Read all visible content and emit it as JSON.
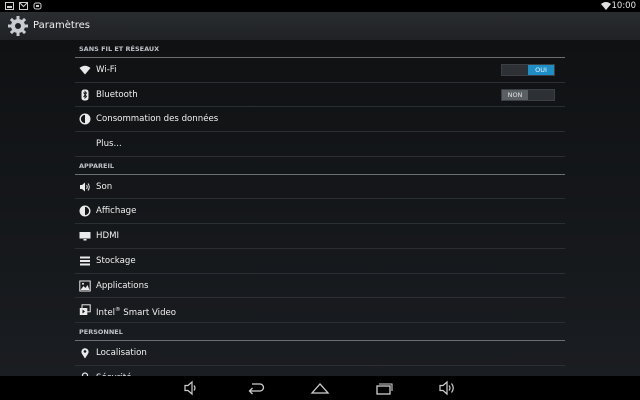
{
  "status_bar": {
    "time": "10:00"
  },
  "action_bar": {
    "title": "Paramètres"
  },
  "sections": [
    {
      "title": "SANS FIL ET RÉSEAUX"
    },
    {
      "title": "APPAREIL"
    },
    {
      "title": "PERSONNEL"
    }
  ],
  "items": {
    "wifi": {
      "label": "Wi-Fi",
      "toggle": "OUI"
    },
    "bluetooth": {
      "label": "Bluetooth",
      "toggle": "NON"
    },
    "data_usage": {
      "label": "Consommation des données"
    },
    "more": {
      "label": "Plus..."
    },
    "sound": {
      "label": "Son"
    },
    "display": {
      "label": "Affichage"
    },
    "hdmi": {
      "label": "HDMI"
    },
    "storage": {
      "label": "Stockage"
    },
    "apps": {
      "label": "Applications"
    },
    "intel_video": {
      "label_prefix": "Intel",
      "sup": "®",
      "label_suffix": " Smart Video"
    },
    "location": {
      "label": "Localisation"
    },
    "security": {
      "label": "Sécurité"
    }
  },
  "colors": {
    "accent": "#1e8fc5",
    "toggle_off": "#5a5f64"
  },
  "nav_icons": [
    "volume-down-icon",
    "back-icon",
    "home-icon",
    "recents-icon",
    "volume-up-icon"
  ]
}
